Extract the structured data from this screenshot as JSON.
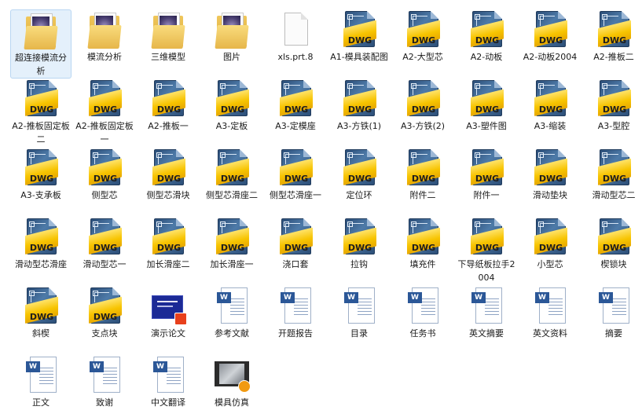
{
  "items": [
    {
      "label": "超连接模流分析",
      "type": "folder"
    },
    {
      "label": "模流分析",
      "type": "folder"
    },
    {
      "label": "三维模型",
      "type": "folder"
    },
    {
      "label": "图片",
      "type": "folder"
    },
    {
      "label": "xls.prt.8",
      "type": "doc"
    },
    {
      "label": "A1-模具装配图",
      "type": "dwg"
    },
    {
      "label": "A2-大型芯",
      "type": "dwg"
    },
    {
      "label": "A2-动板",
      "type": "dwg"
    },
    {
      "label": "A2-动板2004",
      "type": "dwg"
    },
    {
      "label": "A2-推板二",
      "type": "dwg"
    },
    {
      "label": "A2-推板固定板二",
      "type": "dwg"
    },
    {
      "label": "A2-推板固定板一",
      "type": "dwg"
    },
    {
      "label": "A2-推板一",
      "type": "dwg"
    },
    {
      "label": "A3-定板",
      "type": "dwg"
    },
    {
      "label": "A3-定模座",
      "type": "dwg"
    },
    {
      "label": "A3-方铁(1)",
      "type": "dwg"
    },
    {
      "label": "A3-方铁(2)",
      "type": "dwg"
    },
    {
      "label": "A3-塑件图",
      "type": "dwg"
    },
    {
      "label": "A3-缩装",
      "type": "dwg"
    },
    {
      "label": "A3-型腔",
      "type": "dwg"
    },
    {
      "label": "A3-支承板",
      "type": "dwg"
    },
    {
      "label": "侧型芯",
      "type": "dwg"
    },
    {
      "label": "侧型芯滑块",
      "type": "dwg"
    },
    {
      "label": "侧型芯滑座二",
      "type": "dwg"
    },
    {
      "label": "侧型芯滑座一",
      "type": "dwg"
    },
    {
      "label": "定位环",
      "type": "dwg"
    },
    {
      "label": "附件二",
      "type": "dwg"
    },
    {
      "label": "附件一",
      "type": "dwg"
    },
    {
      "label": "滑动垫块",
      "type": "dwg"
    },
    {
      "label": "滑动型芯二",
      "type": "dwg"
    },
    {
      "label": "滑动型芯滑座",
      "type": "dwg"
    },
    {
      "label": "滑动型芯一",
      "type": "dwg"
    },
    {
      "label": "加长滑座二",
      "type": "dwg"
    },
    {
      "label": "加长滑座一",
      "type": "dwg"
    },
    {
      "label": "浇口套",
      "type": "dwg"
    },
    {
      "label": "拉钩",
      "type": "dwg"
    },
    {
      "label": "填充件",
      "type": "dwg"
    },
    {
      "label": "下导纸板拉手2004",
      "type": "dwg"
    },
    {
      "label": "小型芯",
      "type": "dwg"
    },
    {
      "label": "楔锁块",
      "type": "dwg"
    },
    {
      "label": "斜楔",
      "type": "dwg"
    },
    {
      "label": "支点块",
      "type": "dwg"
    },
    {
      "label": "演示论文",
      "type": "ppt"
    },
    {
      "label": "参考文献",
      "type": "word"
    },
    {
      "label": "开题报告",
      "type": "word"
    },
    {
      "label": "目录",
      "type": "word"
    },
    {
      "label": "任务书",
      "type": "word"
    },
    {
      "label": "英文摘要",
      "type": "word"
    },
    {
      "label": "英文资料",
      "type": "word"
    },
    {
      "label": "摘要",
      "type": "word"
    },
    {
      "label": "正文",
      "type": "word"
    },
    {
      "label": "致谢",
      "type": "word"
    },
    {
      "label": "中文翻译",
      "type": "word"
    },
    {
      "label": "模具仿真",
      "type": "video"
    }
  ],
  "dwg_tag": "DWG",
  "word_badge": "W"
}
